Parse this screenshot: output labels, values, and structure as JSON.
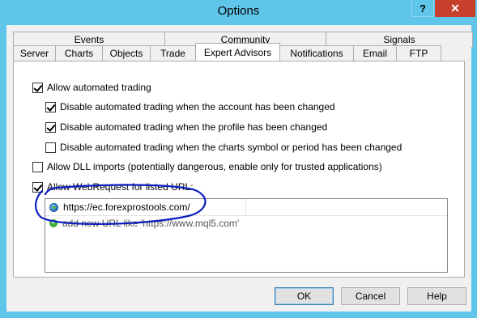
{
  "window": {
    "title": "Options",
    "help": "?",
    "close": "✕"
  },
  "tabs": {
    "row1": [
      "Events",
      "Community",
      "Signals"
    ],
    "row2": [
      "Server",
      "Charts",
      "Objects",
      "Trade",
      "Expert Advisors",
      "Notifications",
      "Email",
      "FTP"
    ],
    "active": "Expert Advisors"
  },
  "options": {
    "allow_auto": {
      "label": "Allow automated trading",
      "checked": true
    },
    "disable_account": {
      "label": "Disable automated trading when the account has been changed",
      "checked": true
    },
    "disable_profile": {
      "label": "Disable automated trading when the profile has been changed",
      "checked": true
    },
    "disable_symbol": {
      "label": "Disable automated trading when the charts symbol or period has been changed",
      "checked": false
    },
    "allow_dll": {
      "label": "Allow DLL imports (potentially dangerous, enable only for trusted applications)",
      "checked": false
    },
    "allow_webrequest": {
      "label": "Allow WebRequest for listed URL:",
      "checked": true
    }
  },
  "url_list": {
    "urls": [
      "https://ec.forexprostools.com/"
    ],
    "add_placeholder": "add new URL like 'https://www.mql5.com'"
  },
  "buttons": {
    "ok": "OK",
    "cancel": "Cancel",
    "help": "Help"
  },
  "colors": {
    "titlebar": "#5fc6ea",
    "close": "#c7402c",
    "annotation": "#0a1fbf"
  },
  "icons": {
    "url_item": "globe-icon",
    "add": "plus-icon"
  }
}
